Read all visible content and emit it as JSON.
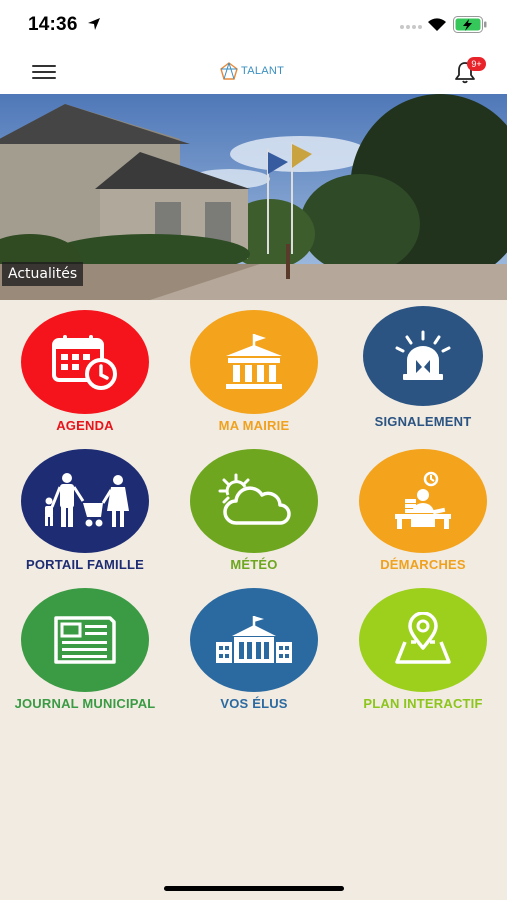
{
  "status_bar": {
    "time": "14:36"
  },
  "nav": {
    "logo_text": "TALANT",
    "notification_badge": "9+"
  },
  "hero": {
    "caption": "Actualités"
  },
  "tiles": [
    {
      "label": "AGENDA",
      "color": "#f5141b",
      "label_color": "#e8141b",
      "icon": "calendar-clock-icon"
    },
    {
      "label": "MA MAIRIE",
      "color": "#f3a31c",
      "label_color": "#f0a21e",
      "icon": "town-hall-icon"
    },
    {
      "label": "SIGNALEMENT",
      "color": "#2b5482",
      "label_color": "#2b5482",
      "icon": "alarm-siren-icon"
    },
    {
      "label": "PORTAIL FAMILLE",
      "color": "#1e2d73",
      "label_color": "#1e2d73",
      "icon": "family-icon"
    },
    {
      "label": "MÉTÉO",
      "color": "#6ea61f",
      "label_color": "#6ea61f",
      "icon": "weather-icon"
    },
    {
      "label": "DÉMARCHES",
      "color": "#f3a31c",
      "label_color": "#f0a21e",
      "icon": "desk-clerk-icon"
    },
    {
      "label": "JOURNAL MUNICIPAL",
      "color": "#3b9b44",
      "label_color": "#3b9b44",
      "icon": "newspaper-icon"
    },
    {
      "label": "VOS ÉLUS",
      "color": "#2b6aa0",
      "label_color": "#2b6aa0",
      "icon": "city-hall-icon"
    },
    {
      "label": "PLAN INTERACTIF",
      "color": "#9dcf1d",
      "label_color": "#8cc51b",
      "icon": "map-pin-icon"
    }
  ]
}
